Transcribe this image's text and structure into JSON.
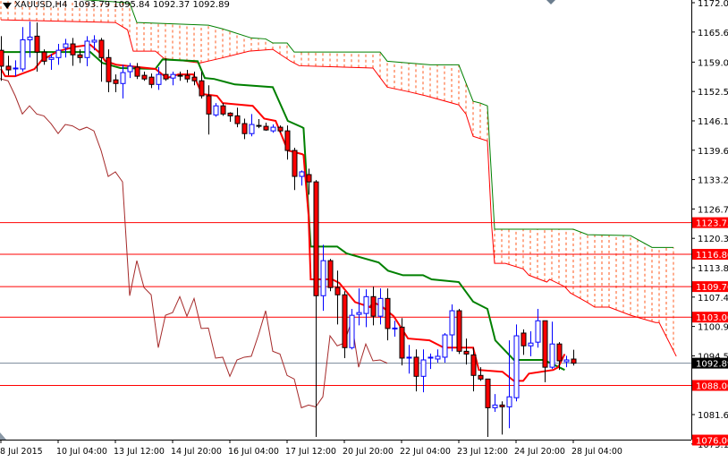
{
  "header": {
    "symbol": "XAUUSD,H4",
    "open": "1093.79",
    "high": "1095.84",
    "low": "1092.37",
    "close": "1092.89"
  },
  "colors": {
    "bull": "#0000ff",
    "bear_fill": "#ff0000",
    "bear_outline": "#000000",
    "tenkan": "#ff0000",
    "kijun": "#008000",
    "chikou": "#a52a2a",
    "cloud_hatch": "#ff5a1e",
    "level": "#ff0000",
    "price_line": "#778899"
  },
  "chart_data": {
    "type": "candlestick",
    "title": "XAUUSD,H4",
    "ylim": [
      1075.15,
      1172.05
    ],
    "y_ticks": [
      "1172.05",
      "1165.60",
      "1159.00",
      "1152.55",
      "1146.10",
      "1139.65",
      "1133.20",
      "1126.75",
      "1120.30",
      "1113.85",
      "1107.40",
      "1100.95",
      "1094.50",
      "1081.60",
      "1075.15"
    ],
    "x_ticks": [
      {
        "bar": 0,
        "label": "8 Jul 2015"
      },
      {
        "bar": 8,
        "label": "10 Jul 04:00"
      },
      {
        "bar": 16,
        "label": "13 Jul 12:00"
      },
      {
        "bar": 24,
        "label": "14 Jul 20:00"
      },
      {
        "bar": 32,
        "label": "16 Jul 04:00"
      },
      {
        "bar": 40,
        "label": "17 Jul 12:00"
      },
      {
        "bar": 48,
        "label": "20 Jul 20:00"
      },
      {
        "bar": 56,
        "label": "22 Jul 04:00"
      },
      {
        "bar": 64,
        "label": "23 Jul 12:00"
      },
      {
        "bar": 72,
        "label": "24 Jul 20:00"
      },
      {
        "bar": 80,
        "label": "28 Jul 04:00"
      }
    ],
    "candles_ohlc": [
      [
        1161.6,
        1164.7,
        1154.9,
        1158.1
      ],
      [
        1158.1,
        1160.4,
        1156.1,
        1157.3
      ],
      [
        1157.5,
        1159.4,
        1155.9,
        1157.7
      ],
      [
        1157.5,
        1166.7,
        1156.9,
        1163.9
      ],
      [
        1163.9,
        1167.9,
        1160.0,
        1164.5
      ],
      [
        1164.7,
        1167.7,
        1156.9,
        1161.2
      ],
      [
        1161.2,
        1161.8,
        1158.4,
        1159.2
      ],
      [
        1159.6,
        1160.8,
        1157.3,
        1160.0
      ],
      [
        1160.0,
        1163.0,
        1158.4,
        1161.6
      ],
      [
        1162.2,
        1164.1,
        1160.0,
        1163.0
      ],
      [
        1163.0,
        1164.3,
        1158.2,
        1160.6
      ],
      [
        1160.6,
        1161.8,
        1158.8,
        1160.0
      ],
      [
        1160.0,
        1164.7,
        1158.1,
        1163.6
      ],
      [
        1163.4,
        1164.9,
        1161.6,
        1163.8
      ],
      [
        1163.8,
        1164.3,
        1154.7,
        1160.0
      ],
      [
        1160.0,
        1161.8,
        1152.4,
        1154.7
      ],
      [
        1155.1,
        1156.3,
        1152.4,
        1154.3
      ],
      [
        1154.3,
        1158.4,
        1151.0,
        1156.7
      ],
      [
        1156.9,
        1158.8,
        1155.5,
        1158.1
      ],
      [
        1157.9,
        1158.8,
        1155.3,
        1155.9
      ],
      [
        1156.1,
        1156.9,
        1154.9,
        1155.3
      ],
      [
        1155.7,
        1156.5,
        1153.3,
        1154.1
      ],
      [
        1154.1,
        1157.9,
        1152.9,
        1156.3
      ],
      [
        1156.3,
        1159.8,
        1154.9,
        1155.3
      ],
      [
        1155.5,
        1156.9,
        1153.9,
        1156.3
      ],
      [
        1156.1,
        1156.9,
        1154.9,
        1156.0
      ],
      [
        1156.1,
        1157.3,
        1154.5,
        1155.3
      ],
      [
        1155.7,
        1156.9,
        1153.9,
        1154.9
      ],
      [
        1154.9,
        1156.9,
        1151.0,
        1151.6
      ],
      [
        1151.6,
        1153.9,
        1143.1,
        1147.6
      ],
      [
        1147.4,
        1150.0,
        1147.0,
        1149.4
      ],
      [
        1149.4,
        1150.0,
        1147.2,
        1147.6
      ],
      [
        1147.8,
        1148.0,
        1145.9,
        1147.2
      ],
      [
        1147.2,
        1149.0,
        1144.7,
        1145.5
      ],
      [
        1145.5,
        1146.6,
        1142.1,
        1143.3
      ],
      [
        1143.3,
        1147.6,
        1142.7,
        1145.3
      ],
      [
        1145.1,
        1146.5,
        1144.5,
        1145.0
      ],
      [
        1144.9,
        1145.7,
        1143.9,
        1144.1
      ],
      [
        1143.9,
        1145.3,
        1143.5,
        1144.7
      ],
      [
        1144.7,
        1145.1,
        1143.5,
        1143.9
      ],
      [
        1143.9,
        1145.1,
        1137.6,
        1139.6
      ],
      [
        1139.6,
        1140.2,
        1130.9,
        1133.9
      ],
      [
        1133.9,
        1135.2,
        1131.9,
        1134.9
      ],
      [
        1134.3,
        1135.6,
        1129.9,
        1132.7
      ],
      [
        1132.7,
        1133.1,
        1076.7,
        1107.7
      ],
      [
        1107.7,
        1118.9,
        1104.4,
        1115.4
      ],
      [
        1115.4,
        1115.8,
        1108.7,
        1109.5
      ],
      [
        1109.5,
        1113.2,
        1101.4,
        1107.9
      ],
      [
        1107.9,
        1108.7,
        1094.0,
        1096.3
      ],
      [
        1096.3,
        1104.8,
        1095.9,
        1103.4
      ],
      [
        1103.6,
        1109.3,
        1101.2,
        1104.0
      ],
      [
        1103.8,
        1109.1,
        1100.8,
        1107.5
      ],
      [
        1107.5,
        1109.7,
        1101.2,
        1103.2
      ],
      [
        1103.2,
        1109.3,
        1101.4,
        1107.1
      ],
      [
        1107.1,
        1109.3,
        1097.9,
        1100.5
      ],
      [
        1100.5,
        1102.2,
        1098.7,
        1100.6
      ],
      [
        1100.8,
        1102.8,
        1092.4,
        1094.0
      ],
      [
        1094.0,
        1096.9,
        1090.6,
        1094.2
      ],
      [
        1094.2,
        1095.9,
        1086.7,
        1090.0
      ],
      [
        1090.0,
        1095.9,
        1086.5,
        1093.6
      ],
      [
        1094.0,
        1095.0,
        1091.6,
        1094.2
      ],
      [
        1093.8,
        1095.9,
        1093.0,
        1094.4
      ],
      [
        1094.2,
        1099.5,
        1093.0,
        1099.1
      ],
      [
        1099.1,
        1105.8,
        1095.5,
        1104.4
      ],
      [
        1104.4,
        1104.8,
        1094.9,
        1095.5
      ],
      [
        1095.5,
        1098.3,
        1092.6,
        1094.9
      ],
      [
        1094.7,
        1096.3,
        1086.7,
        1090.2
      ],
      [
        1090.2,
        1092.0,
        1089.0,
        1089.4
      ],
      [
        1089.4,
        1089.4,
        1076.7,
        1083.1
      ],
      [
        1083.1,
        1086.1,
        1082.2,
        1083.7
      ],
      [
        1083.7,
        1084.5,
        1077.2,
        1083.3
      ],
      [
        1083.3,
        1097.9,
        1078.6,
        1085.5
      ],
      [
        1085.3,
        1101.4,
        1084.5,
        1098.9
      ],
      [
        1099.5,
        1100.3,
        1094.7,
        1096.7
      ],
      [
        1096.7,
        1099.9,
        1094.4,
        1097.3
      ],
      [
        1097.5,
        1104.8,
        1096.3,
        1102.2
      ],
      [
        1102.2,
        1102.2,
        1088.7,
        1092.0
      ],
      [
        1092.0,
        1102.0,
        1091.6,
        1097.1
      ],
      [
        1097.1,
        1097.5,
        1091.4,
        1093.4
      ],
      [
        1093.2,
        1094.5,
        1092.0,
        1093.6
      ],
      [
        1093.79,
        1095.84,
        1092.37,
        1092.89
      ]
    ],
    "tenkan_sen": [
      [
        0,
        1157.5
      ],
      [
        0.6,
        1155.9
      ],
      [
        2,
        1155.9
      ],
      [
        4.7,
        1157.5
      ],
      [
        5.7,
        1159.4
      ],
      [
        8,
        1161.4
      ],
      [
        10.5,
        1162.4
      ],
      [
        12.5,
        1162.8
      ],
      [
        13.7,
        1161.2
      ],
      [
        14.6,
        1159.2
      ],
      [
        16.2,
        1158.4
      ],
      [
        21.6,
        1157.5
      ],
      [
        23.2,
        1155.5
      ],
      [
        24.8,
        1156.3
      ],
      [
        26.9,
        1156.3
      ],
      [
        28.1,
        1152.0
      ],
      [
        30.2,
        1151.6
      ],
      [
        31,
        1150.0
      ],
      [
        35.2,
        1149.4
      ],
      [
        36.8,
        1146.6
      ],
      [
        38.4,
        1146.1
      ],
      [
        40.1,
        1139.6
      ],
      [
        42.1,
        1138.8
      ],
      [
        42.3,
        1138.6
      ],
      [
        43,
        1125.4
      ],
      [
        43.3,
        1111.3
      ],
      [
        46.3,
        1111.3
      ],
      [
        47.3,
        1110.5
      ],
      [
        49.5,
        1106.3
      ],
      [
        51.6,
        1105.2
      ],
      [
        52,
        1106.3
      ],
      [
        53.2,
        1105.4
      ],
      [
        54.9,
        1103.2
      ],
      [
        56.9,
        1098.3
      ],
      [
        59.9,
        1097.9
      ],
      [
        61.9,
        1096.3
      ],
      [
        66,
        1096.3
      ],
      [
        66.8,
        1091.4
      ],
      [
        70.1,
        1091.0
      ],
      [
        71.7,
        1089.0
      ],
      [
        73,
        1089.0
      ],
      [
        73.8,
        1090.6
      ],
      [
        77.2,
        1091.4
      ],
      [
        77.9,
        1092.0
      ],
      [
        78.8,
        1094.9
      ]
    ],
    "kijun_sen": [
      [
        0,
        1161.2
      ],
      [
        12.5,
        1161.2
      ],
      [
        14.2,
        1158.8
      ],
      [
        16.7,
        1157.7
      ],
      [
        21.6,
        1157.5
      ],
      [
        22.6,
        1159.6
      ],
      [
        27.5,
        1159.2
      ],
      [
        28.5,
        1155.5
      ],
      [
        29.8,
        1155.3
      ],
      [
        32.7,
        1154.1
      ],
      [
        38,
        1153.5
      ],
      [
        40.1,
        1146.1
      ],
      [
        42.1,
        1144.7
      ],
      [
        42.3,
        1144.5
      ],
      [
        43.3,
        1118.5
      ],
      [
        47,
        1118.5
      ],
      [
        48.3,
        1117.0
      ],
      [
        52.8,
        1115.0
      ],
      [
        54.1,
        1113.2
      ],
      [
        56.2,
        1112.2
      ],
      [
        59,
        1112.2
      ],
      [
        60.2,
        1111.3
      ],
      [
        64,
        1110.7
      ],
      [
        66,
        1106.4
      ],
      [
        68,
        1104.8
      ],
      [
        69.1,
        1097.9
      ],
      [
        71.7,
        1093.6
      ],
      [
        75.9,
        1093.6
      ],
      [
        78.8,
        1091.4
      ]
    ],
    "senkou_span_a": [
      [
        0,
        1168.3
      ],
      [
        16,
        1167.7
      ],
      [
        17.7,
        1166.1
      ],
      [
        18.5,
        1161.4
      ],
      [
        21.6,
        1161.4
      ],
      [
        22.8,
        1159.8
      ],
      [
        27.8,
        1158.8
      ],
      [
        30.6,
        1159.8
      ],
      [
        34.7,
        1161.4
      ],
      [
        38,
        1161.8
      ],
      [
        40.5,
        1159.2
      ],
      [
        41.7,
        1158.2
      ],
      [
        52,
        1157.7
      ],
      [
        54,
        1153.5
      ],
      [
        57,
        1152.5
      ],
      [
        59.4,
        1151.6
      ],
      [
        64,
        1149.6
      ],
      [
        65,
        1147.6
      ],
      [
        66,
        1142.7
      ],
      [
        68,
        1141.7
      ],
      [
        68.6,
        1122.9
      ],
      [
        69,
        1114.8
      ],
      [
        70.5,
        1114.8
      ],
      [
        73,
        1113.6
      ],
      [
        73.8,
        1112.2
      ],
      [
        76.3,
        1110.7
      ],
      [
        76.7,
        1111.3
      ],
      [
        78.8,
        1109.7
      ],
      [
        79.6,
        1108.3
      ],
      [
        82,
        1106.2
      ],
      [
        83,
        1105.2
      ],
      [
        85,
        1105.2
      ],
      [
        88,
        1103.4
      ],
      [
        91.5,
        1101.8
      ],
      [
        92,
        1101.8
      ],
      [
        94.4,
        1094.4
      ]
    ],
    "senkou_span_b": [
      [
        0,
        1174
      ],
      [
        18,
        1172
      ],
      [
        19,
        1167.7
      ],
      [
        29,
        1167.1
      ],
      [
        31,
        1166.3
      ],
      [
        35,
        1164.3
      ],
      [
        37,
        1164.1
      ],
      [
        38,
        1163.2
      ],
      [
        40,
        1163.2
      ],
      [
        41,
        1161.2
      ],
      [
        53,
        1161.2
      ],
      [
        54,
        1159.2
      ],
      [
        60,
        1158.4
      ],
      [
        64,
        1158.4
      ],
      [
        66,
        1150.4
      ],
      [
        67,
        1150.0
      ],
      [
        68,
        1149.4
      ],
      [
        69,
        1122.3
      ],
      [
        80,
        1122.3
      ],
      [
        82,
        1121.1
      ],
      [
        88,
        1120.9
      ],
      [
        91,
        1118.3
      ],
      [
        94,
        1118.3
      ]
    ],
    "chikou_shift": 26,
    "levels": [
      {
        "value": 1123.75,
        "label": "1123.75"
      },
      {
        "value": 1116.8,
        "label": "1116.80"
      },
      {
        "value": 1109.7,
        "label": "1109.70"
      },
      {
        "value": 1103.0,
        "label": "1103.00"
      },
      {
        "value": 1088.0,
        "label": "1088.00"
      },
      {
        "value": 1076.0,
        "label": "1076.00"
      }
    ],
    "current_price": {
      "value": 1092.89,
      "label": "1092.89"
    }
  }
}
